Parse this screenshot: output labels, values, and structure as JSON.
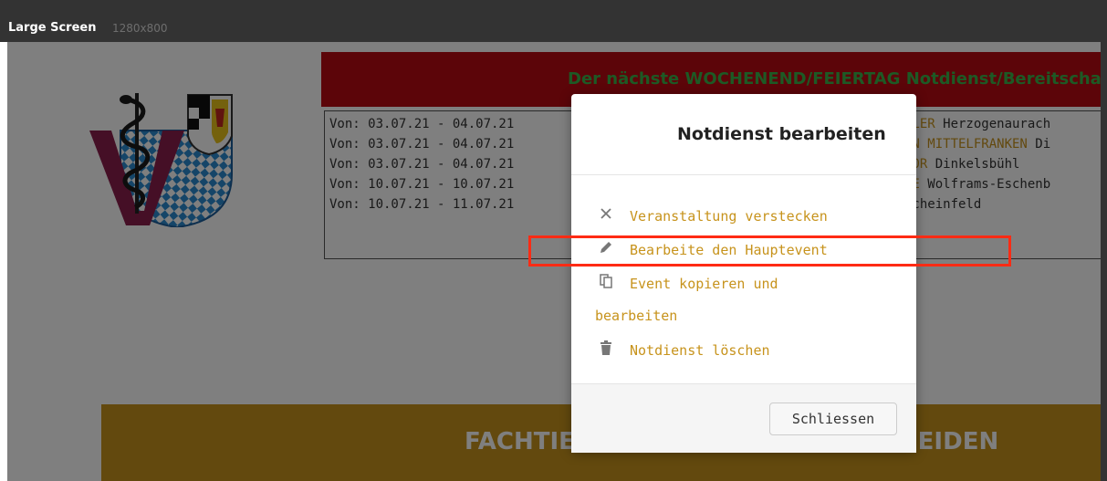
{
  "preview": {
    "label": "Large Screen",
    "resolution": "1280x800"
  },
  "emergency": {
    "header": "Der nächste WOCHENEND/FEIERTAG Notdienst/Bereitschaftsd",
    "rows": [
      {
        "dates": "Von: 03.07.21 - 04.07.21",
        "hl": "KLER",
        "rest": " Herzogenaurach"
      },
      {
        "dates": "Von: 03.07.21 - 04.07.21",
        "hl": "IN MITTELFRANKEN",
        "rest": " Di"
      },
      {
        "dates": "Von: 03.07.21 - 04.07.21",
        "hl": "DOR",
        "rest": " Dinkelsbühl"
      },
      {
        "dates": "Von: 10.07.21 - 10.07.21",
        "hl": "NE",
        "rest": " Wolframs-Eschenb"
      },
      {
        "dates": "Von: 10.07.21 - 11.07.21",
        "hl": "",
        "rest": " Scheinfeld"
      }
    ]
  },
  "banner": {
    "left": "FACHTIE",
    "right": "IEIDEN"
  },
  "modal": {
    "title": "Notdienst bearbeiten",
    "items": [
      {
        "icon": "close-icon",
        "label": "Veranstaltung verstecken"
      },
      {
        "icon": "pencil-icon",
        "label": "Bearbeite den Hauptevent"
      },
      {
        "icon": "copy-icon",
        "label_line1": "Event kopieren und",
        "label_line2": "bearbeiten"
      },
      {
        "icon": "trash-icon",
        "label": "Notdienst löschen"
      }
    ],
    "close_label": "Schliessen"
  },
  "colors": {
    "red": "#b90a12",
    "gold": "#c7931c",
    "green": "#3bb54a",
    "highlight": "#ff2b14"
  }
}
